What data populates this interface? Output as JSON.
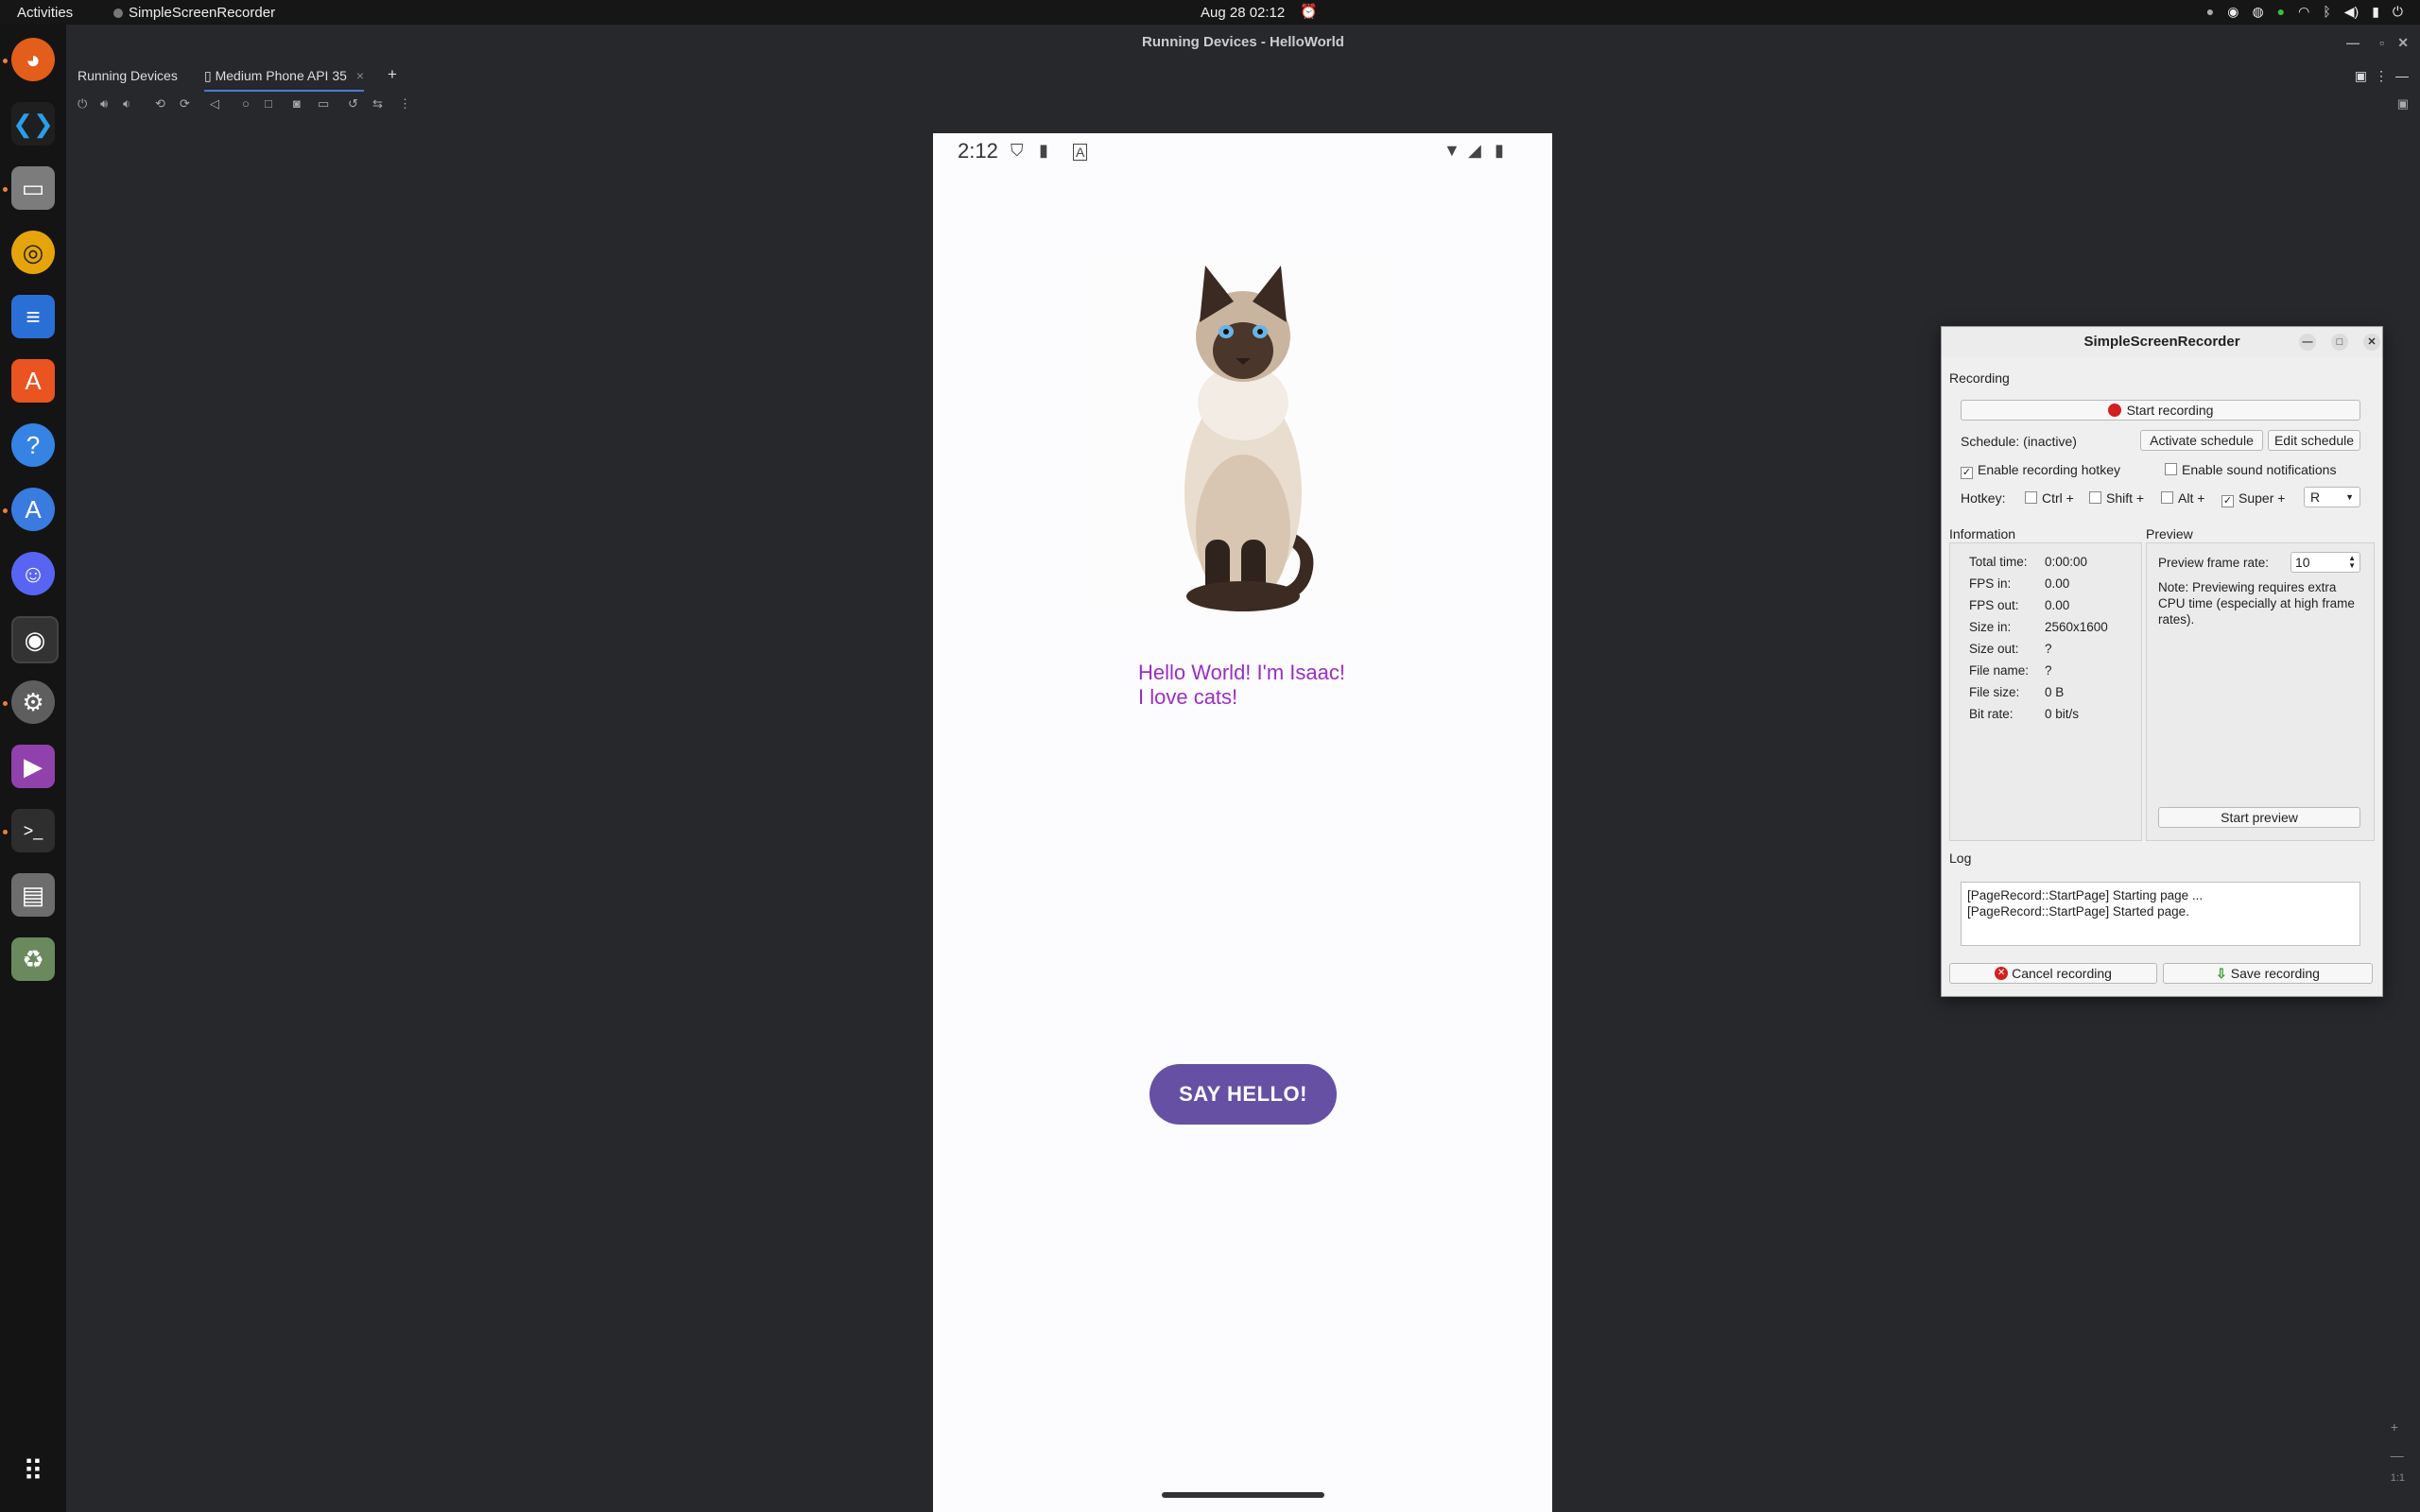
{
  "topbar": {
    "activities": "Activities",
    "app_name": "SimpleScreenRecorder",
    "clock": "Aug 28  02:12"
  },
  "ide": {
    "title": "Running Devices - HelloWorld",
    "tabs": [
      {
        "label": "Running Devices"
      },
      {
        "label": "Medium Phone API 35"
      }
    ]
  },
  "phone": {
    "time": "2:12",
    "hello_line1": "Hello World! I'm Isaac!",
    "hello_line2": "I love cats!",
    "button_label": "SAY HELLO!"
  },
  "ssr": {
    "title": "SimpleScreenRecorder",
    "recording_group": "Recording",
    "start_recording": "Start recording",
    "schedule_label": "Schedule: (inactive)",
    "activate_schedule": "Activate schedule",
    "edit_schedule": "Edit schedule",
    "enable_hotkey": "Enable recording hotkey",
    "enable_sound": "Enable sound notifications",
    "hotkey_label": "Hotkey:",
    "ctrl": "Ctrl +",
    "shift": "Shift +",
    "alt": "Alt +",
    "super": "Super +",
    "key": "R",
    "information_group": "Information",
    "info": [
      {
        "k": "Total time:",
        "v": "0:00:00"
      },
      {
        "k": "FPS in:",
        "v": "0.00"
      },
      {
        "k": "FPS out:",
        "v": "0.00"
      },
      {
        "k": "Size in:",
        "v": "2560x1600"
      },
      {
        "k": "Size out:",
        "v": "?"
      },
      {
        "k": "File name:",
        "v": "?"
      },
      {
        "k": "File size:",
        "v": "0 B"
      },
      {
        "k": "Bit rate:",
        "v": "0 bit/s"
      }
    ],
    "preview_group": "Preview",
    "preview_frame_rate_label": "Preview frame rate:",
    "preview_frame_rate": "10",
    "preview_note": "Note: Previewing requires extra CPU time (especially at high frame rates).",
    "start_preview": "Start preview",
    "log_group": "Log",
    "log_line1": "[PageRecord::StartPage] Starting page ...",
    "log_line2": "[PageRecord::StartPage] Started page.",
    "cancel_recording": "Cancel recording",
    "save_recording": "Save recording"
  },
  "zoom": {
    "ratio": "1:1"
  }
}
